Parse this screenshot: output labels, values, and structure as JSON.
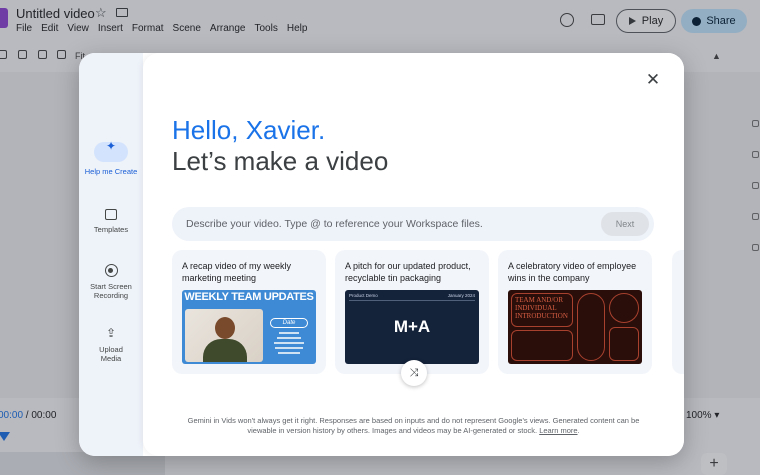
{
  "app": {
    "doc_title": "Untitled video",
    "menu": [
      "File",
      "Edit",
      "View",
      "Insert",
      "Format",
      "Scene",
      "Arrange",
      "Tools",
      "Help"
    ],
    "toolbar_fit_label": "Fit",
    "play_label": "Play",
    "share_label": "Share",
    "time_current": "00:00",
    "time_sep": " / ",
    "time_total": "00:00",
    "zoom": "100%",
    "zoom_caret": "▾",
    "add_label": "+"
  },
  "dialog": {
    "close_glyph": "✕",
    "sidebar": [
      {
        "label": "Help me Create",
        "icon": "sparkle-icon"
      },
      {
        "label": "Templates",
        "icon": "templates-icon"
      },
      {
        "label": "Start Screen Recording",
        "icon": "record-icon"
      },
      {
        "label": "Upload Media",
        "icon": "upload-icon"
      }
    ],
    "greeting": "Hello, Xavier.",
    "headline": "Let’s make a video",
    "prompt_placeholder": "Describe your video. Type @ to reference your Workspace files.",
    "next_label": "Next",
    "cards": [
      {
        "title": "A recap video of my weekly marketing meeting",
        "thumb_header": "WEEKLY TEAM UPDATES",
        "thumb_pill": "Date"
      },
      {
        "title": "A pitch for our updated product, recyclable tin packaging",
        "thumb_left": "Product Demo",
        "thumb_right": "January 2024",
        "thumb_big": "M+A"
      },
      {
        "title": "A celebratory video of employee wins in the company",
        "thumb_text": "TEAM AND/OR INDIVIDUAL INTRODUCTION"
      }
    ],
    "shuffle_glyph": "⤨",
    "disclaimer": "Gemini in Vids won't always get it right. Responses are based on inputs and do not represent Google's views. Generated content can be viewable in version history by others. Images and videos may be AI-generated or stock.",
    "learn_more": "Learn more",
    "colors": {
      "accent": "#1a73e8",
      "pill": "#d3e3fd",
      "scrim": "rgba(40,44,52,0.30)"
    }
  }
}
